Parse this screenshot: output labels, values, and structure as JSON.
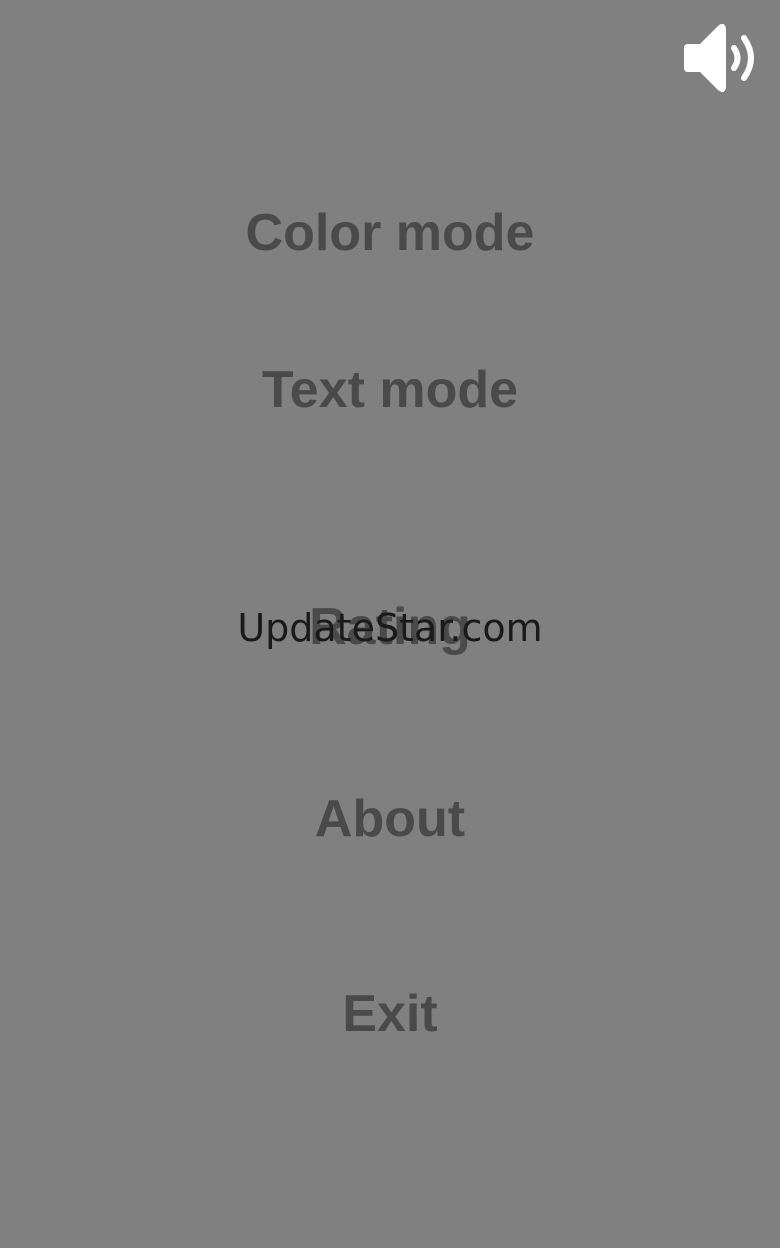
{
  "sound": {
    "icon": "speaker-volume-icon",
    "state": "on",
    "icon_color": "#ffffff"
  },
  "menu": {
    "items": [
      {
        "label": "Color mode"
      },
      {
        "label": "Text mode"
      },
      {
        "label": "Rating"
      },
      {
        "label": "About"
      },
      {
        "label": "Exit"
      }
    ],
    "text_color": "#4a4a4a"
  },
  "watermark": {
    "text": "UpdateStar.com"
  },
  "colors": {
    "background": "#808080"
  }
}
